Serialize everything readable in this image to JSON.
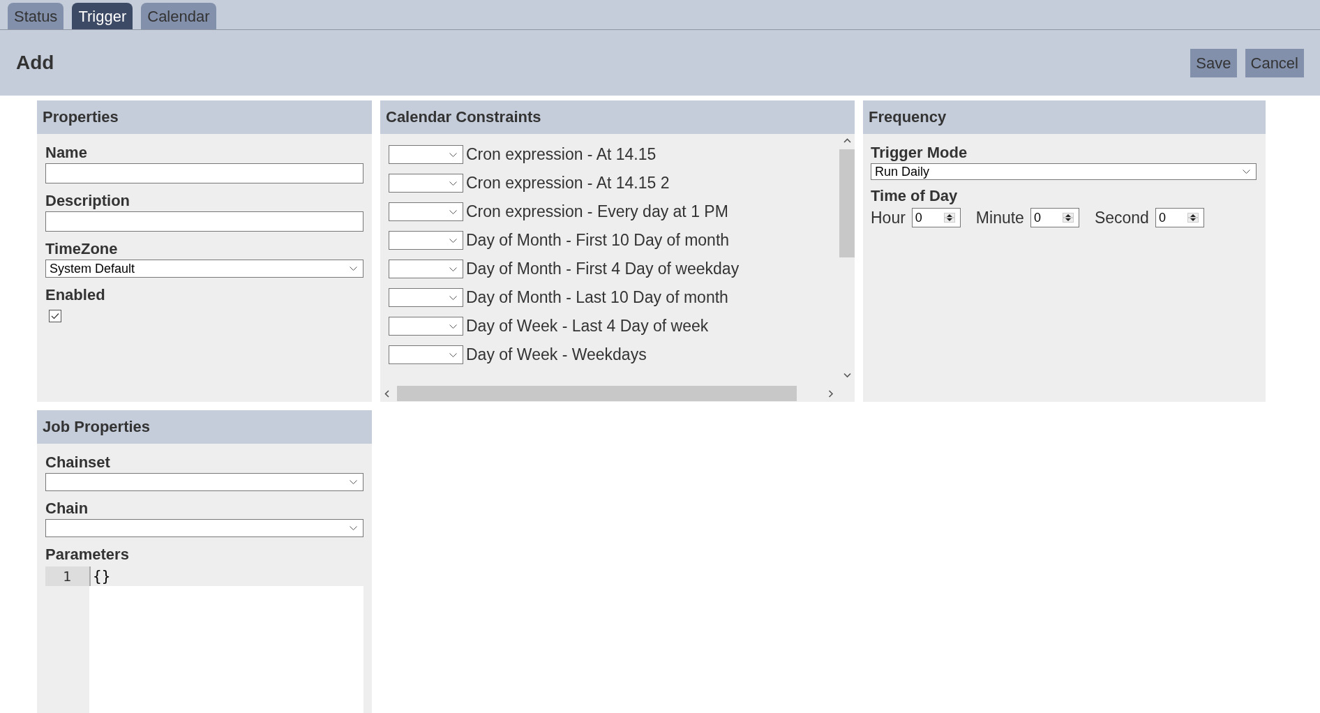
{
  "tabs": [
    {
      "label": "Status",
      "selected": false
    },
    {
      "label": "Trigger",
      "selected": true
    },
    {
      "label": "Calendar",
      "selected": false
    }
  ],
  "header": {
    "title": "Add",
    "buttons": [
      "Save",
      "Cancel"
    ]
  },
  "properties": {
    "title": "Properties",
    "fields": [
      {
        "kind": "text",
        "label": "Name"
      },
      {
        "kind": "text",
        "label": "Description"
      },
      {
        "kind": "select",
        "label": "TimeZone",
        "value": "System Default"
      },
      {
        "kind": "checkbox",
        "label": "Enabled",
        "checked": true
      }
    ]
  },
  "calendar_constraints": {
    "title": "Calendar Constraints",
    "items": [
      {
        "label": "Cron expression - At 14.15"
      },
      {
        "label": "Cron expression - At 14.15 2"
      },
      {
        "label": "Cron expression - Every day at 1 PM"
      },
      {
        "label": "Day of Month - First 10 Day of month"
      },
      {
        "label": "Day of Month - First 4 Day of weekday"
      },
      {
        "label": "Day of Month - Last 10 Day of month"
      },
      {
        "label": "Day of Week - Last 4 Day of week"
      },
      {
        "label": "Day of Week - Weekdays"
      }
    ]
  },
  "frequency": {
    "title": "Frequency",
    "trigger_mode": {
      "label": "Trigger Mode",
      "value": "Run Daily"
    },
    "time_of_day": {
      "label": "Time of Day",
      "fields": [
        {
          "label": "Hour",
          "value": "0"
        },
        {
          "label": "Minute",
          "value": "0"
        },
        {
          "label": "Second",
          "value": "0"
        }
      ]
    }
  },
  "job_properties": {
    "title": "Job Properties",
    "fields": [
      {
        "kind": "select",
        "label": "Chainset"
      },
      {
        "kind": "select",
        "label": "Chain"
      },
      {
        "kind": "code",
        "label": "Parameters",
        "lines": [
          {
            "number": "1",
            "text": "{}"
          }
        ]
      }
    ]
  }
}
